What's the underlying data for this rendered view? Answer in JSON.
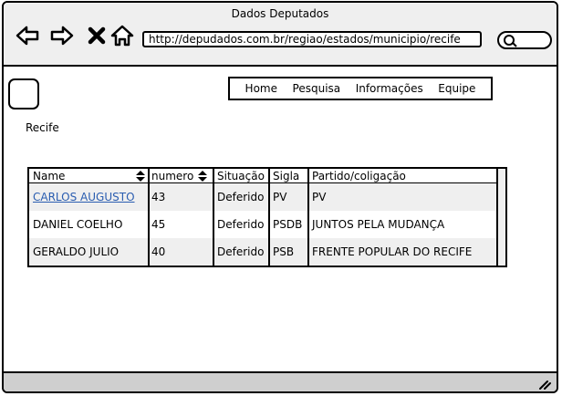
{
  "window": {
    "title": "Dados Deputados"
  },
  "browser": {
    "url": "http://depudados.com.br/regiao/estados/municipio/recife"
  },
  "page": {
    "menu": [
      "Home",
      "Pesquisa",
      "Informações",
      "Equipe"
    ],
    "city": "Recife"
  },
  "table": {
    "headers": [
      "Name",
      "numero",
      "Situação",
      "Sigla",
      "Partido/coligação"
    ],
    "rows": [
      [
        "CARLOS AUGUSTO",
        "43",
        "Deferido",
        "PV",
        "PV"
      ],
      [
        "DANIEL COELHO",
        "45",
        "Deferido",
        "PSDB",
        "JUNTOS PELA MUDANÇA"
      ],
      [
        "GERALDO JULIO",
        "40",
        "Deferido",
        "PSB",
        "FRENTE POPULAR DO RECIFE"
      ]
    ]
  },
  "colors": {
    "link": "#2a5db0",
    "chrome": "#efefef",
    "statusbar": "#cfcfcf"
  },
  "icons": [
    "back-arrow-icon",
    "forward-arrow-icon",
    "close-icon",
    "home-icon",
    "search-icon",
    "sort-icon",
    "resize-grip-icon"
  ]
}
